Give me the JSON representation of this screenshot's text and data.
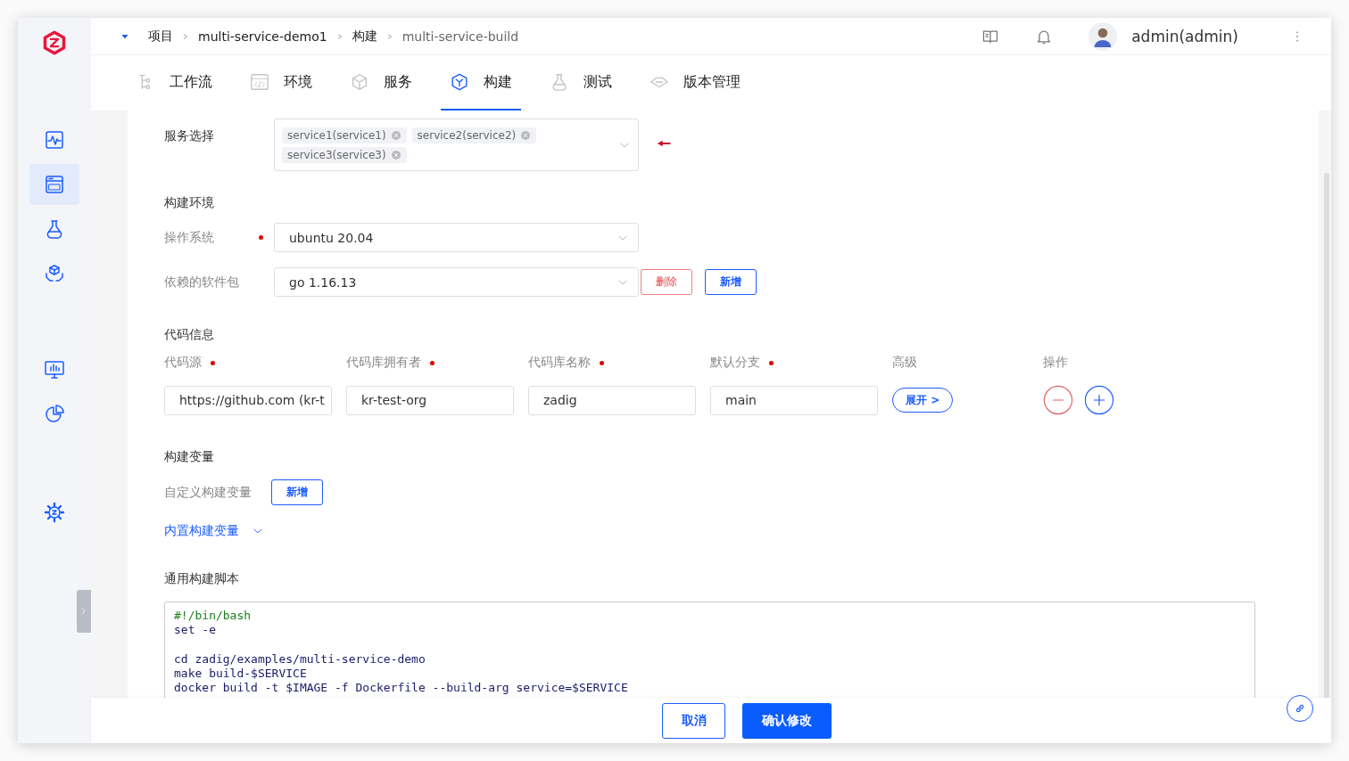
{
  "breadcrumb": [
    "项目",
    "multi-service-demo1",
    "构建",
    "multi-service-build"
  ],
  "user": {
    "name": "admin(admin)"
  },
  "sidebar": {
    "items": [
      {
        "selected": false
      },
      {
        "selected": true
      },
      {
        "selected": false
      },
      {
        "selected": false
      },
      {
        "selected": false
      },
      {
        "selected": false
      },
      {
        "selected": false
      }
    ]
  },
  "tabs": [
    {
      "label": "工作流",
      "selected": false
    },
    {
      "label": "环境",
      "selected": false
    },
    {
      "label": "服务",
      "selected": false
    },
    {
      "label": "构建",
      "selected": true
    },
    {
      "label": "测试",
      "selected": false
    },
    {
      "label": "版本管理",
      "selected": false
    }
  ],
  "service_select": {
    "label": "服务选择",
    "tags": [
      "service1(service1)",
      "service2(service2)",
      "service3(service3)"
    ]
  },
  "build_env": {
    "title": "构建环境",
    "os": {
      "label": "操作系统",
      "required": true,
      "value": "ubuntu 20.04"
    },
    "packages": {
      "label": "依赖的软件包",
      "value": "go 1.16.13",
      "buttons": [
        "删除",
        "新增"
      ]
    }
  },
  "code_info": {
    "title": "代码信息",
    "columns": [
      {
        "label": "代码源",
        "required": true
      },
      {
        "label": "代码库拥有者",
        "required": true
      },
      {
        "label": "代码库名称",
        "required": true
      },
      {
        "label": "默认分支",
        "required": true
      },
      {
        "label": "高级",
        "required": false
      },
      {
        "label": "操作",
        "required": false
      }
    ],
    "row": {
      "source": "https://github.com (kr-t",
      "owner": "kr-test-org",
      "repo": "zadig",
      "branch": "main",
      "advanced": "展开 >"
    }
  },
  "build_vars": {
    "title": "构建变量",
    "custom_label": "自定义构建变量",
    "add": "新增",
    "builtin": "内置构建变量",
    "builtin_expanded": false
  },
  "script": {
    "title": "通用构建脚本",
    "lines": [
      {
        "kind": "comment",
        "text": "#!/bin/bash"
      },
      {
        "kind": "code",
        "text": "set -e"
      },
      {
        "kind": "blank"
      },
      {
        "kind": "code",
        "text": "cd zadig/examples/multi-service-demo"
      },
      {
        "kind": "code",
        "text": "make build-$SERVICE"
      },
      {
        "kind": "code",
        "text": "docker build -t $IMAGE -f Dockerfile --build-arg service=$SERVICE"
      }
    ]
  },
  "footer": {
    "cancel": "取消",
    "confirm": "确认修改"
  }
}
